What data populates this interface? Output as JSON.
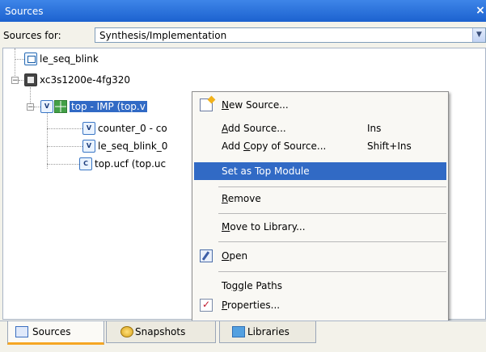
{
  "window": {
    "title": "Sources"
  },
  "sources_for": {
    "label": "Sources for:",
    "value": "Synthesis/Implementation"
  },
  "tree": {
    "nodes": [
      {
        "label": "le_seq_blink"
      },
      {
        "label": "xc3s1200e-4fg320",
        "expander": "−"
      },
      {
        "label": "top - IMP (top.v",
        "expander": "−"
      },
      {
        "label": "counter_0 - co"
      },
      {
        "label": "le_seq_blink_0"
      },
      {
        "label": "top.ucf (top.uc"
      }
    ]
  },
  "context_menu": {
    "new_source": {
      "label": "New Source...",
      "underline": "N",
      "rest": "ew Source..."
    },
    "add_source": {
      "label": "Add Source...",
      "underline": "A",
      "rest": "dd Source...",
      "shortcut": "Ins"
    },
    "add_copy": {
      "pre": "Add ",
      "underline": "C",
      "rest": "opy of Source...",
      "shortcut": "Shift+Ins"
    },
    "set_top": {
      "label": "Set as Top Module"
    },
    "remove": {
      "underline": "R",
      "rest": "emove"
    },
    "move_to_library": {
      "underline": "M",
      "rest": "ove to Library..."
    },
    "open": {
      "underline": "O",
      "rest": "pen"
    },
    "toggle_paths": {
      "pre": "To",
      "underline": "g",
      "rest": "gle Paths"
    },
    "properties": {
      "underline": "P",
      "rest": "roperties..."
    }
  },
  "tabs": [
    {
      "label": "Sources",
      "active": true
    },
    {
      "label": "Snapshots",
      "active": false
    },
    {
      "label": "Libraries",
      "active": false
    }
  ],
  "colors": {
    "titlebar": "#1c62cf",
    "selection": "#316ac5",
    "active_tab_accent": "#f5a623"
  }
}
